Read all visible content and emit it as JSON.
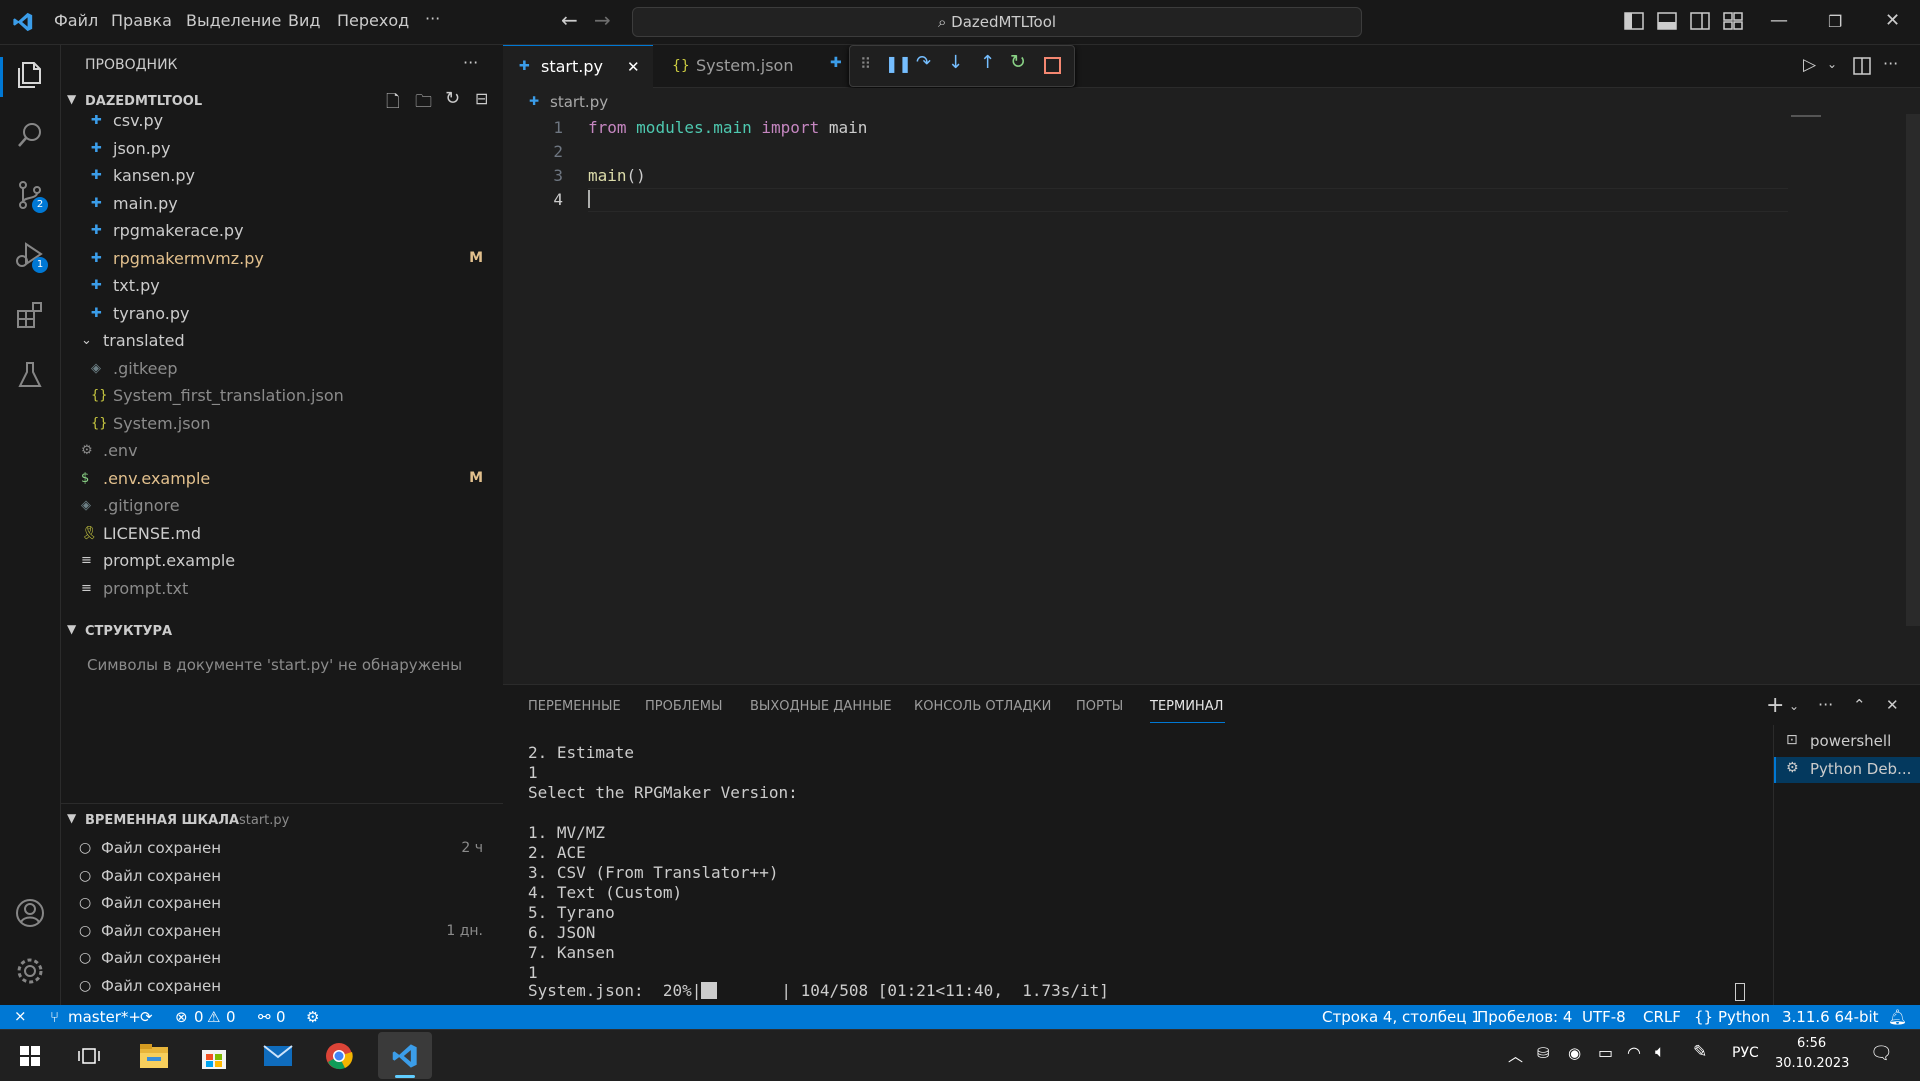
{
  "menu": {
    "items": [
      "Файл",
      "Правка",
      "Выделение",
      "Вид",
      "Переход",
      "···"
    ],
    "command_center": "DazedMTLTool"
  },
  "activity": {
    "scm_badge": "2",
    "debug_badge": "1"
  },
  "explorer": {
    "header": "ПРОВОДНИК",
    "more": "···",
    "project": "DAZEDMTLTOOL",
    "files": [
      {
        "label": "csv.py",
        "status": ""
      },
      {
        "label": "json.py",
        "status": ""
      },
      {
        "label": "kansen.py",
        "status": ""
      },
      {
        "label": "main.py",
        "status": ""
      },
      {
        "label": "rpgmakerace.py",
        "status": ""
      },
      {
        "label": "rpgmakermvmz.py",
        "status": "M"
      },
      {
        "label": "txt.py",
        "status": ""
      },
      {
        "label": "tyrano.py",
        "status": ""
      }
    ],
    "translated_folder": "translated",
    "translated_files": [
      ".gitkeep",
      "System_first_translation.json",
      "System.json"
    ],
    "root_files": [
      {
        "label": ".env",
        "status": ""
      },
      {
        "label": ".env.example",
        "status": "M"
      },
      {
        "label": ".gitignore",
        "status": ""
      },
      {
        "label": "LICENSE.md",
        "status": ""
      },
      {
        "label": "prompt.example",
        "status": ""
      },
      {
        "label": "prompt.txt",
        "status": ""
      }
    ]
  },
  "outline": {
    "title": "СТРУКТУРА",
    "message": "Символы в документе 'start.py' не обнаружены"
  },
  "timeline": {
    "title": "ВРЕМЕННАЯ ШКАЛА",
    "file": "start.py",
    "items": [
      {
        "label": "Файл сохранен",
        "time": "2 ч"
      },
      {
        "label": "Файл сохранен",
        "time": ""
      },
      {
        "label": "Файл сохранен",
        "time": ""
      },
      {
        "label": "Файл сохранен",
        "time": "1 дн."
      },
      {
        "label": "Файл сохранен",
        "time": ""
      },
      {
        "label": "Файл сохранен",
        "time": ""
      }
    ]
  },
  "editor": {
    "tabs": [
      {
        "label": "start.py",
        "close": "✕"
      },
      {
        "label": "System.json"
      }
    ],
    "breadcrumb": "start.py",
    "lines": [
      "1",
      "2",
      "3",
      "4"
    ],
    "code": {
      "l1_kw1": "from",
      "l1_mod": "modules.main",
      "l1_kw2": "import",
      "l1_name": "main",
      "l3_fn": "main",
      "l3_paren": "()"
    }
  },
  "panel": {
    "tabs": [
      "ПЕРЕМЕННЫЕ",
      "ПРОБЛЕМЫ",
      "ВЫХОДНЫЕ ДАННЫЕ",
      "КОНСОЛЬ ОТЛАДКИ",
      "ПОРТЫ",
      "ТЕРМИНАЛ"
    ],
    "terminal_lines": [
      "2. Estimate",
      "1",
      "Select the RPGMaker Version:",
      "",
      "1. MV/MZ",
      "2. ACE",
      "3. CSV (From Translator++)",
      "4. Text (Custom)",
      "5. Tyrano",
      "6. JSON",
      "7. Kansen",
      "1"
    ],
    "progress_label": "System.json:  20%|",
    "progress_fraction": 0.2,
    "progress_rest": "| 104/508 [01:21<11:40,  1.73s/it]",
    "terminals": [
      "powershell",
      "Python Deb..."
    ]
  },
  "status": {
    "branch": "master*+",
    "errors": "0",
    "warnings": "0",
    "ports": "0",
    "position": "Строка 4, столбец 1",
    "spaces": "Пробелов: 4",
    "encoding": "UTF-8",
    "eol": "CRLF",
    "language": "Python",
    "interpreter": "3.11.6 64-bit"
  },
  "taskbar": {
    "lang": "РУС",
    "time": "6:56",
    "date": "30.10.2023"
  },
  "colors": {
    "accent": "#0078d4",
    "modified": "#e2c08d",
    "background": "#1f1f1f"
  }
}
